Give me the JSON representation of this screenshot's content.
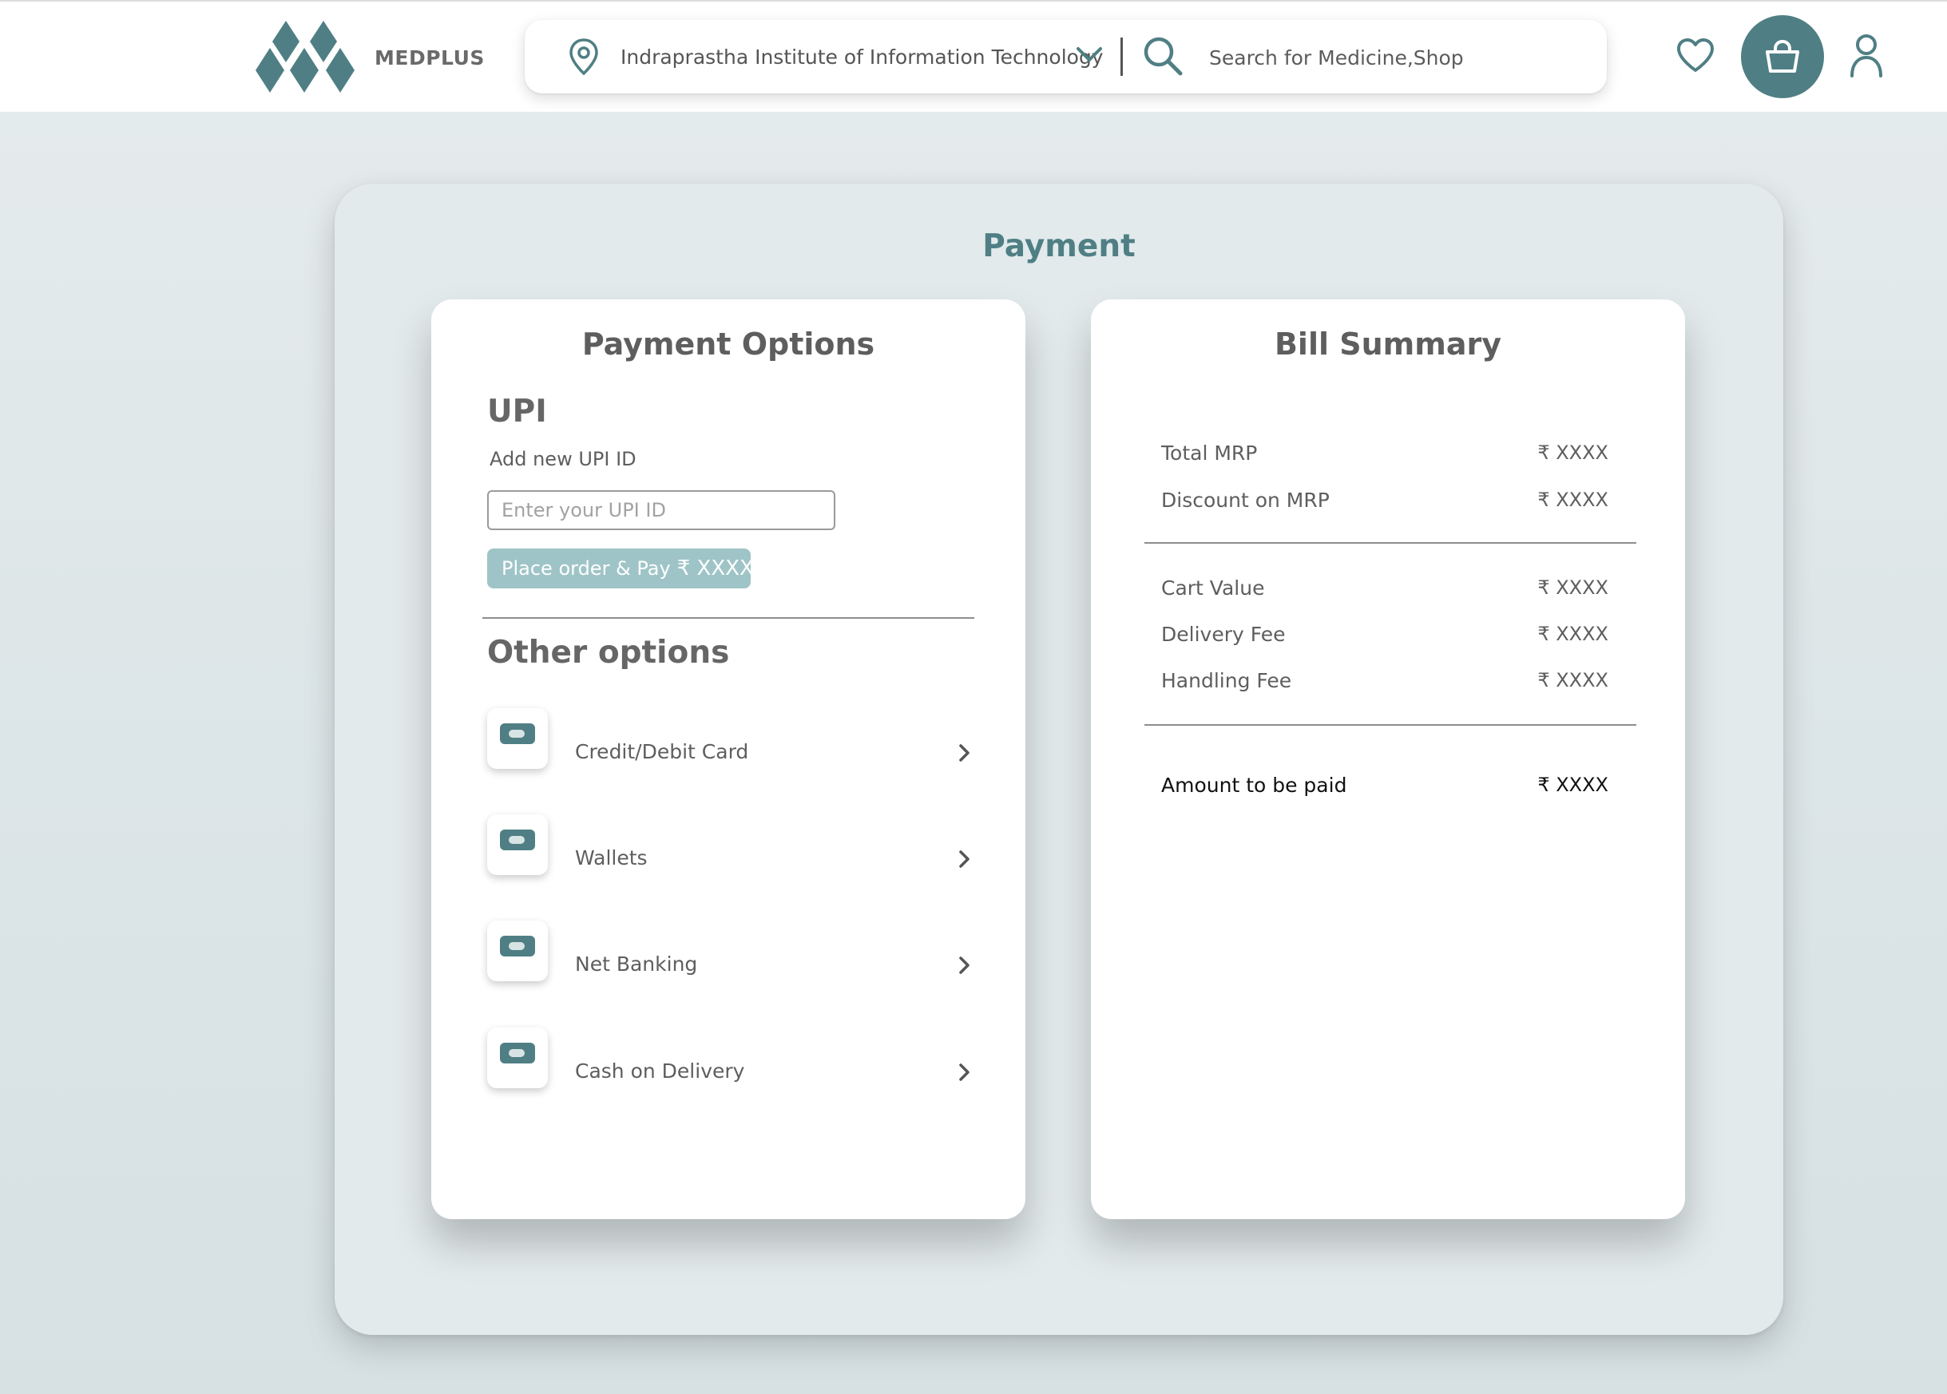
{
  "header": {
    "brand": "MEDPLUS",
    "location": "Indraprastha Institute of Information Technology",
    "search_placeholder": "Search for Medicine,Shop",
    "accent_color": "#4f7f84",
    "icons": [
      "logo-diamonds-icon",
      "location-pin-icon",
      "chevron-down-icon",
      "search-icon",
      "heart-icon",
      "shopping-bag-icon",
      "user-icon"
    ]
  },
  "page": {
    "title": "Payment"
  },
  "payment_options": {
    "title": "Payment Options",
    "upi_title": "UPI",
    "upi_subtitle": "Add new UPI ID",
    "upi_placeholder": "Enter your UPI ID",
    "pay_button_label": "Place order & Pay",
    "pay_button_amount": "₹ XXXX",
    "other_title": "Other options",
    "options": [
      {
        "label": "Credit/Debit Card"
      },
      {
        "label": "Wallets"
      },
      {
        "label": "Net Banking"
      },
      {
        "label": "Cash on Delivery"
      }
    ]
  },
  "bill_summary": {
    "title": "Bill Summary",
    "rows": [
      {
        "label": "Total MRP",
        "value": "₹ XXXX"
      },
      {
        "label": "Discount on MRP",
        "value": "₹ XXXX"
      },
      {
        "label": "Cart Value",
        "value": "₹ XXXX"
      },
      {
        "label": "Delivery Fee",
        "value": "₹ XXXX"
      },
      {
        "label": "Handling Fee",
        "value": "₹ XXXX"
      }
    ],
    "total": {
      "label": "Amount to be paid",
      "value": "₹ XXXX"
    }
  }
}
